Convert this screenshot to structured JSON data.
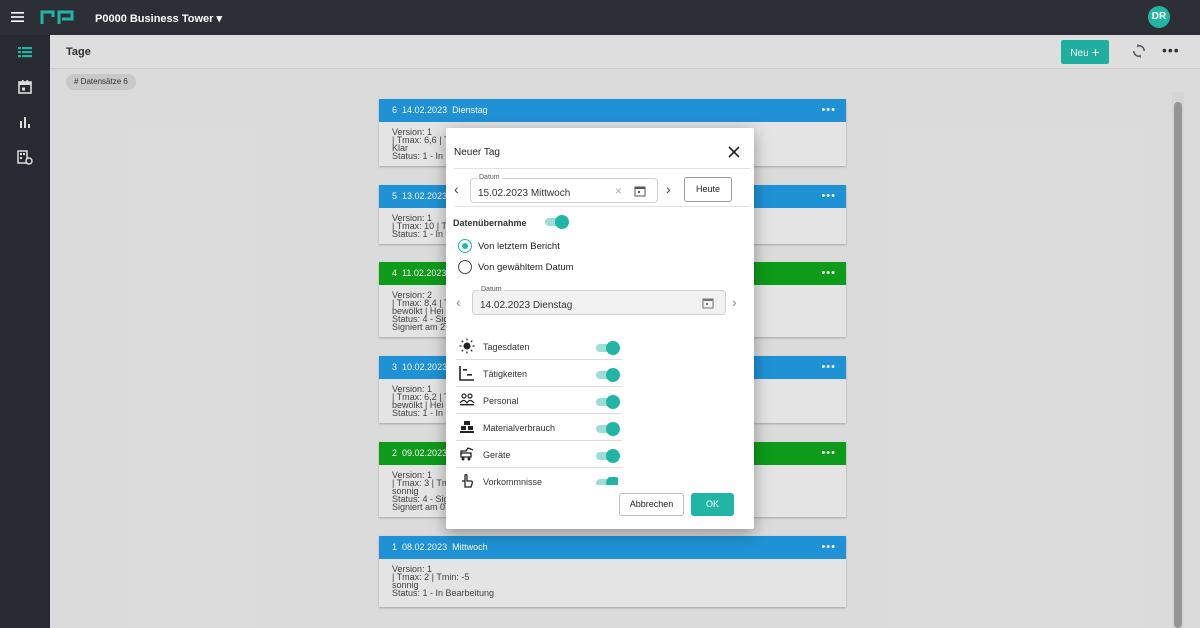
{
  "app": {
    "project_name": "P0000 Business Tower",
    "user_initials": "DR"
  },
  "colors": {
    "accent": "#21b5a6",
    "card_blue": "#2196dc",
    "card_green": "#0fa11a",
    "topbar": "#2c2f36"
  },
  "header": {
    "title": "Tage",
    "new_button": "Neu",
    "new_button_icon": "plus-icon",
    "refresh_icon": "refresh-icon",
    "more_icon": "more-icon"
  },
  "records_chip": "# Datensätze 6",
  "cards": [
    {
      "number": "6",
      "date": "14.02.2023",
      "weekday": "Dienstag",
      "color": "blue",
      "lines": [
        "Version: 1",
        "| Tmax: 6,6 | T",
        "Klar",
        "Status: 1 - In"
      ]
    },
    {
      "number": "5",
      "date": "13.02.2023",
      "weekday": "",
      "color": "blue",
      "lines": [
        "Version: 1",
        "| Tmax: 10 | T",
        "Status: 1 - In"
      ]
    },
    {
      "number": "4",
      "date": "11.02.2023",
      "weekday": "",
      "color": "green",
      "lines": [
        "Version: 2",
        "| Tmax: 8,4 | T",
        "bewölkt | Hei",
        "Status: 4 - Sig",
        "Signiert am 2"
      ]
    },
    {
      "number": "3",
      "date": "10.02.2023",
      "weekday": "",
      "color": "blue",
      "lines": [
        "Version: 1",
        "| Tmax: 6,2 | T",
        "bewölkt | Hei",
        "Status: 1 - In"
      ]
    },
    {
      "number": "2",
      "date": "09.02.2023",
      "weekday": "",
      "color": "green",
      "lines": [
        "Version: 1",
        "| Tmax: 3 | Tm",
        "sonnig",
        "Status: 4 - Sig",
        "Signiert am 0"
      ]
    },
    {
      "number": "1",
      "date": "08.02.2023",
      "weekday": "Mittwoch",
      "color": "blue",
      "lines": [
        "Version: 1",
        "| Tmax: 2 | Tmin: -5",
        "sonnig",
        "Status: 1 - In Bearbeitung"
      ]
    }
  ],
  "modal": {
    "title": "Neuer Tag",
    "date_field": {
      "label": "Datum",
      "value": "15.02.2023 Mittwoch"
    },
    "today_button": "Heute",
    "data_transfer_label": "Datenübernahme",
    "data_transfer_on": true,
    "radio_options": [
      {
        "label": "Von letztem Bericht",
        "selected": true
      },
      {
        "label": "Von gewähltem Datum",
        "selected": false
      }
    ],
    "source_date_field": {
      "label": "Datum",
      "value": "14.02.2023 Dienstag"
    },
    "categories": [
      {
        "label": "Tagesdaten",
        "icon": "sun-icon",
        "on": true
      },
      {
        "label": "Tätigkeiten",
        "icon": "activities-icon",
        "on": true
      },
      {
        "label": "Personal",
        "icon": "personnel-icon",
        "on": true
      },
      {
        "label": "Materialverbrauch",
        "icon": "material-icon",
        "on": true
      },
      {
        "label": "Geräte",
        "icon": "equipment-icon",
        "on": true
      },
      {
        "label": "Vorkommnisse",
        "icon": "incident-icon",
        "on": true
      }
    ],
    "cancel_button": "Abbrechen",
    "ok_button": "OK"
  }
}
